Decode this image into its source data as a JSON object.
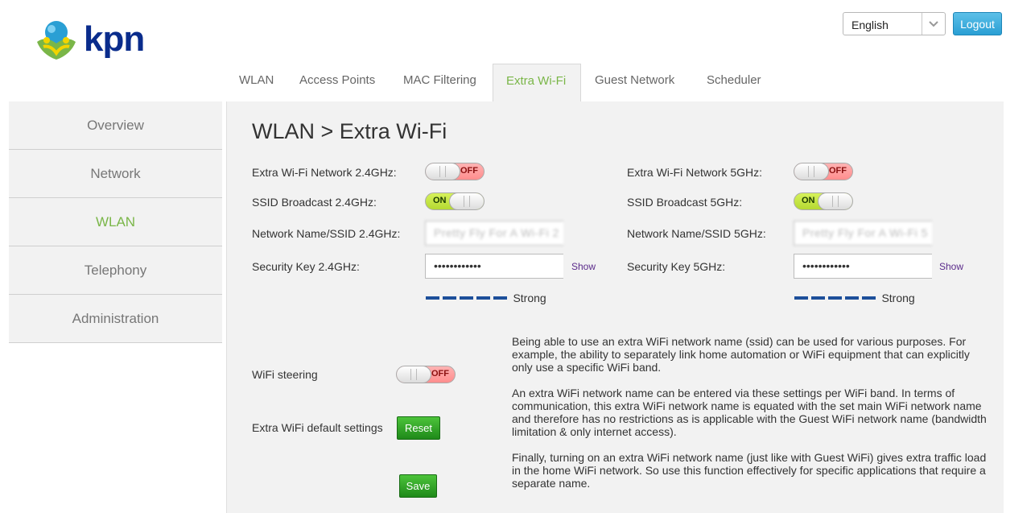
{
  "brand": {
    "name": "kpn",
    "colors": {
      "accent": "#7ab648",
      "brand": "#0a2c8c",
      "logout": "#2a9fd4"
    }
  },
  "header": {
    "language": "English",
    "logout_label": "Logout"
  },
  "tabs": [
    {
      "label": "WLAN"
    },
    {
      "label": "Access Points"
    },
    {
      "label": "MAC Filtering"
    },
    {
      "label": "Extra Wi-Fi",
      "active": true
    },
    {
      "label": "Guest Network"
    },
    {
      "label": "Scheduler"
    }
  ],
  "sidebar": {
    "items": [
      {
        "label": "Overview"
      },
      {
        "label": "Network"
      },
      {
        "label": "WLAN",
        "active": true
      },
      {
        "label": "Telephony"
      },
      {
        "label": "Administration"
      }
    ]
  },
  "page": {
    "title": "WLAN > Extra Wi-Fi",
    "band24": {
      "extra_label": "Extra Wi-Fi Network 2.4GHz:",
      "extra_state": "OFF",
      "ssid_broadcast_label": "SSID Broadcast 2.4GHz:",
      "ssid_broadcast_state": "ON",
      "ssid_label": "Network Name/SSID 2.4GHz:",
      "ssid_value": "Pretty Fly For A Wi-Fi 2",
      "key_label": "Security Key 2.4GHz:",
      "key_value": "••••••••••••",
      "show_label": "Show",
      "strength_label": "Strong"
    },
    "band5": {
      "extra_label": "Extra Wi-Fi Network 5GHz:",
      "extra_state": "OFF",
      "ssid_broadcast_label": "SSID Broadcast 5GHz:",
      "ssid_broadcast_state": "ON",
      "ssid_label": "Network Name/SSID 5GHz:",
      "ssid_value": "Pretty Fly For A Wi-Fi 5",
      "key_label": "Security Key 5GHz:",
      "key_value": "••••••••••••",
      "show_label": "Show",
      "strength_label": "Strong"
    },
    "steering_label": "WiFi steering",
    "steering_state": "OFF",
    "defaults_label": "Extra WiFi default settings",
    "reset_label": "Reset",
    "save_label": "Save",
    "info": {
      "p1": "Being able to use an extra WiFi network name (ssid) can be used for various purposes. For example, the ability to separately link home automation or WiFi equipment that can explicitly only use a specific WiFi band.",
      "p2": "An extra WiFi network name can be entered via these settings per WiFi band. In terms of communication, this extra WiFi network name is equated with the set main WiFi network name and therefore has no restrictions as is applicable with the Guest WiFi network name (bandwidth limitation & only internet access).",
      "p3": "Finally, turning on an extra WiFi network name (just like with Guest WiFi) gives extra traffic load in the home WiFi network. So use this function effectively for specific applications that require a separate name."
    }
  }
}
